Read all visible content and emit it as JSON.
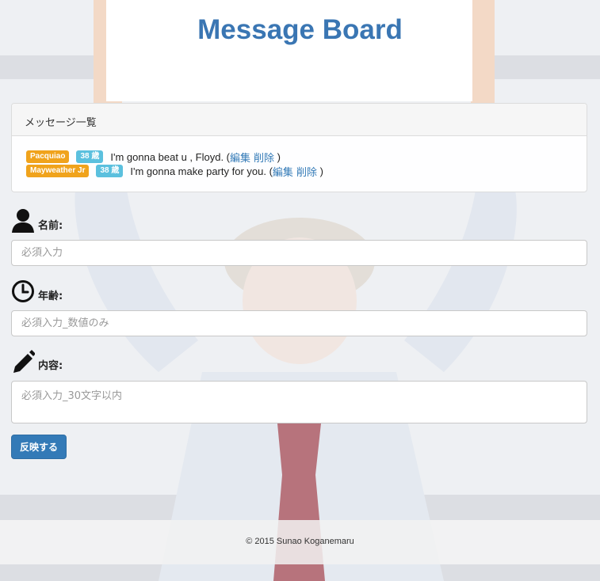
{
  "header": {
    "title": "Message Board"
  },
  "messages_panel": {
    "heading": "メッセージ一覧",
    "messages": [
      {
        "name": "Pacquiao",
        "age": "38 歳",
        "text": "I'm gonna beat u , Floyd.",
        "open": " (",
        "edit": "編集",
        "delete": "削除",
        "close": " )"
      },
      {
        "name": "Mayweather Jr",
        "age": "38 歳",
        "text": "I'm gonna make party for you.",
        "open": " (",
        "edit": "編集",
        "delete": "削除",
        "close": " )"
      }
    ]
  },
  "form": {
    "name_label": "名前:",
    "name_placeholder": "必須入力",
    "age_label": "年齢:",
    "age_placeholder": "必須入力_数値のみ",
    "content_label": "内容:",
    "content_placeholder": "必須入力_30文字以内",
    "submit_label": "反映する"
  },
  "footer": {
    "copyright": "© 2015 Sunao Koganemaru"
  },
  "icons": {
    "name": "user-icon",
    "age": "clock-icon",
    "content": "pencil-icon"
  },
  "colors": {
    "title": "#3a76b3",
    "badge_name": "#f0a31c",
    "badge_age": "#5bc0de",
    "primary": "#337ab7"
  }
}
